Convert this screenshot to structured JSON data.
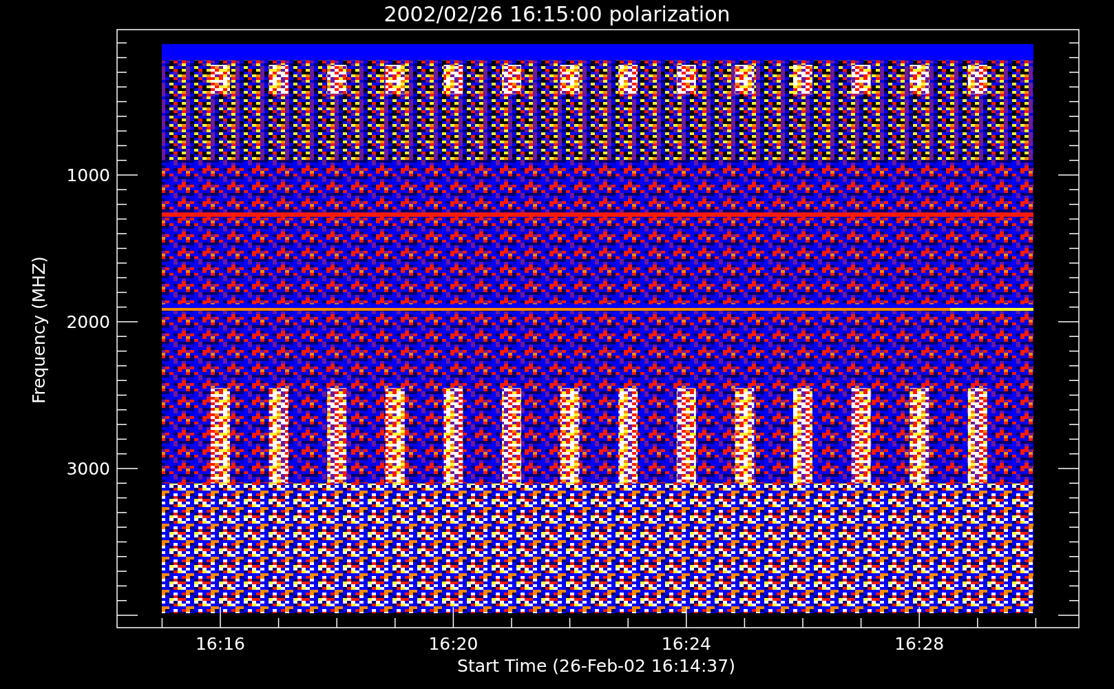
{
  "title": "2002/02/26 16:15:00 polarization",
  "y_axis": {
    "label": "Frequency (MHZ)",
    "ticks": [
      "1000",
      "2000",
      "3000"
    ]
  },
  "x_axis": {
    "label": "Start Time (26-Feb-02 16:14:37)",
    "ticks": [
      "16:16",
      "16:20",
      "16:24",
      "16:28"
    ]
  }
}
